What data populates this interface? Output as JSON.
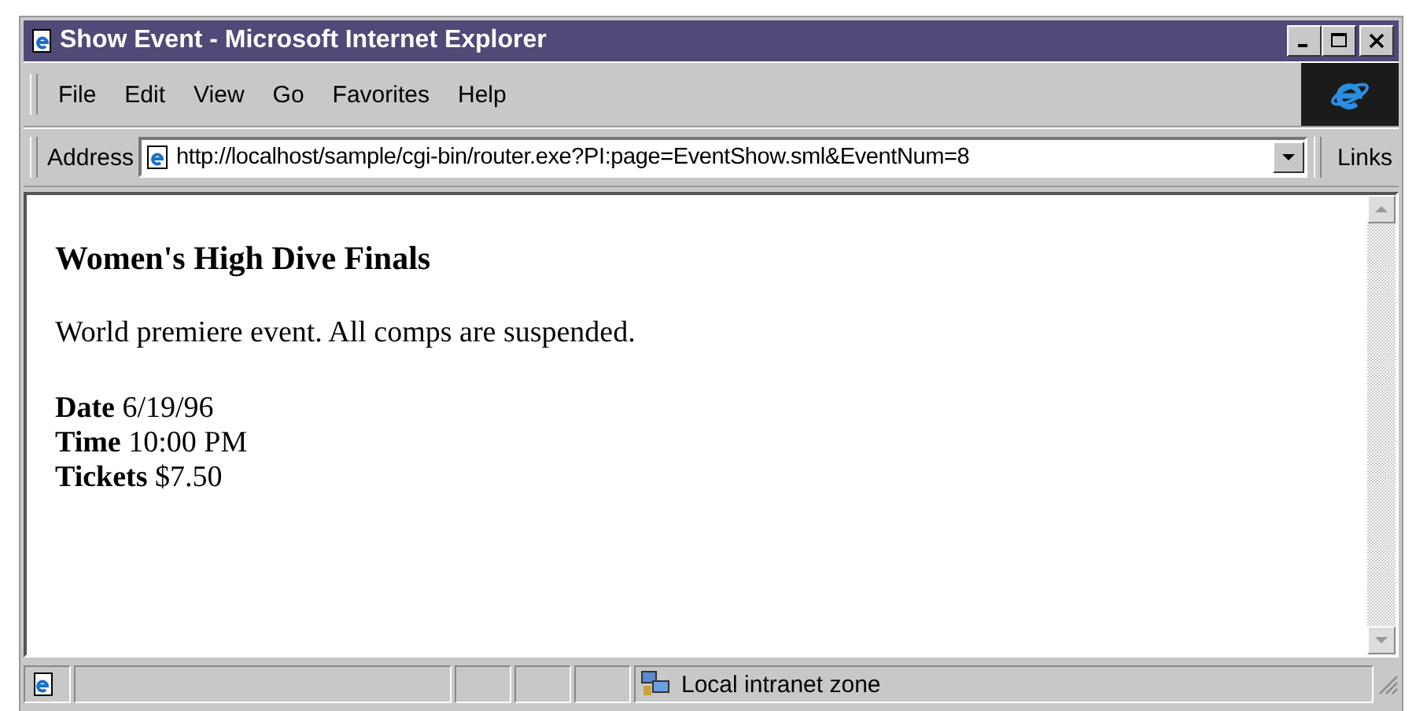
{
  "window": {
    "title": "Show Event - Microsoft Internet Explorer"
  },
  "menu": [
    "File",
    "Edit",
    "View",
    "Go",
    "Favorites",
    "Help"
  ],
  "address_bar": {
    "label": "Address",
    "value": "http://localhost/sample/cgi-bin/router.exe?PI:page=EventShow.sml&EventNum=8",
    "links": "Links"
  },
  "page": {
    "heading": "Women's High Dive Finals",
    "description": "World premiere event. All comps are suspended.",
    "fields": [
      {
        "label": "Date",
        "value": "6/19/96"
      },
      {
        "label": "Time",
        "value": "10:00 PM"
      },
      {
        "label": "Tickets",
        "value": "$7.50"
      }
    ]
  },
  "status_bar": {
    "zone": "Local intranet zone"
  }
}
